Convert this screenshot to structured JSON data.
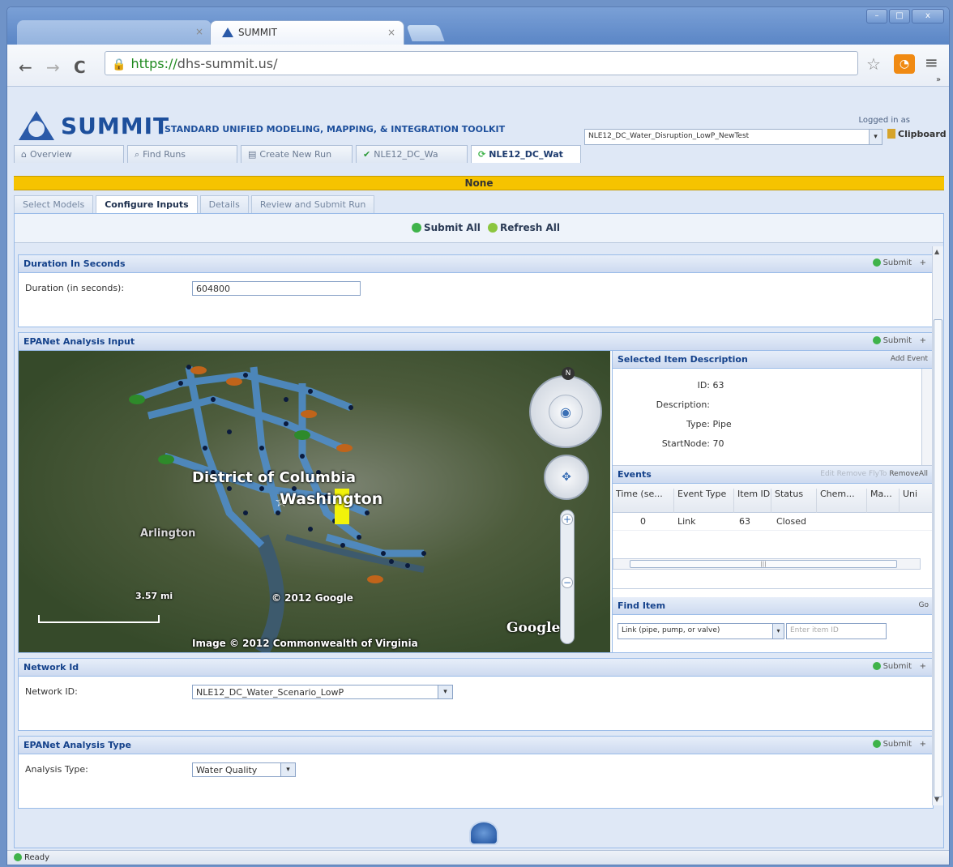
{
  "browser": {
    "tab_active_title": "SUMMIT",
    "tab_close": "×",
    "url_secure": "https://",
    "url_host": "dhs-summit.us/",
    "window_controls": [
      "–",
      "□",
      "x"
    ],
    "more_chevron": "»"
  },
  "app": {
    "brand": "SUMMIT",
    "tagline": "STANDARD UNIFIED MODELING, MAPPING, & INTEGRATION TOOLKIT",
    "logged_in_label": "Logged in as",
    "scenario_value": "NLE12_DC_Water_Disruption_LowP_NewTest",
    "clipboard_label": "Clipboard",
    "main_tabs": [
      {
        "label": "Overview",
        "icon": "home-icon"
      },
      {
        "label": "Find Runs",
        "icon": "magnifier-icon"
      },
      {
        "label": "Create New Run",
        "icon": "form-icon"
      },
      {
        "label": "NLE12_DC_Wa",
        "icon": "check-icon"
      },
      {
        "label": "NLE12_DC_Wat",
        "icon": "refresh-icon"
      }
    ],
    "status_banner": "None",
    "sub_tabs": [
      "Select Models",
      "Configure Inputs",
      "Details",
      "Review and Submit Run"
    ],
    "submit_all": "Submit All",
    "refresh_all": "Refresh All",
    "submit_label": "Submit",
    "plus": "+",
    "status_ready": "Ready"
  },
  "duration": {
    "title": "Duration In Seconds",
    "label": "Duration (in seconds):",
    "value": "604800"
  },
  "epanet": {
    "title": "EPANet Analysis Input",
    "map": {
      "label_district": "District of Columbia",
      "label_city": "Washington",
      "label_arlington": "Arlington",
      "scale": "3.57 mi",
      "copyright": "© 2012 Google",
      "imagery": "Image © 2012 Commonwealth of Virginia",
      "google_logo": "Google",
      "compass_n": "N"
    },
    "selected_item": {
      "title": "Selected Item Description",
      "add_event": "Add Event",
      "id_label": "ID:",
      "id_value": "63",
      "description_label": "Description:",
      "type_label": "Type:",
      "type_value": "Pipe",
      "startnode_label": "StartNode:",
      "startnode_value": "70"
    },
    "events": {
      "title": "Events",
      "actions_dim": "Edit Remove FlyTo",
      "action_remove_all": "RemoveAll",
      "columns": [
        "Time (se...",
        "Event Type",
        "Item ID",
        "Status",
        "Chem...",
        "Ma...",
        "Uni"
      ],
      "rows": [
        {
          "time": "0",
          "event_type": "Link",
          "item_id": "63",
          "status": "Closed"
        }
      ]
    },
    "find_item": {
      "title": "Find Item",
      "go": "Go",
      "type_value": "Link (pipe, pump, or valve)",
      "id_placeholder": "Enter item ID"
    }
  },
  "network": {
    "title": "Network Id",
    "label": "Network ID:",
    "value": "NLE12_DC_Water_Scenario_LowP"
  },
  "analysis_type": {
    "title": "EPANet Analysis Type",
    "label": "Analysis Type:",
    "value": "Water Quality"
  }
}
